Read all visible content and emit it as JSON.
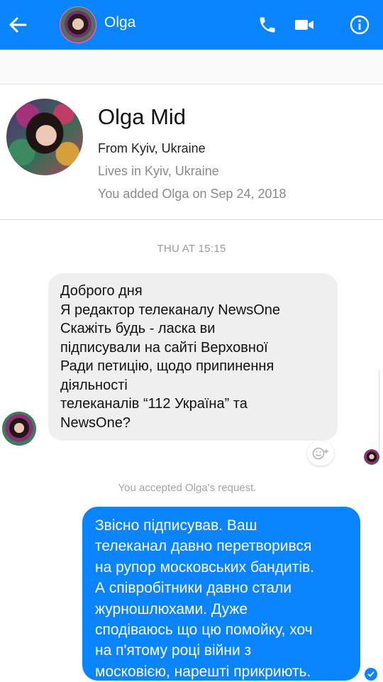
{
  "header": {
    "contact_name": "Olga",
    "accent_color": "#0a84ff",
    "icons": [
      "arrow-left-icon",
      "phone-icon",
      "video-camera-icon",
      "info-icon"
    ]
  },
  "profile": {
    "full_name": "Olga Mid",
    "from": "From Kyiv, Ukraine",
    "lives": "Lives in Kyiv, Ukraine",
    "added": "You added Olga on Sep 24, 2018"
  },
  "conversation": {
    "timestamp": "THU AT 15:15",
    "incoming_message": {
      "lines": [
        "Доброго дня",
        "Я редактор телеканалу NewsOne",
        "Скажіть будь - ласка ви",
        "підписували на сайті Верховної",
        "Ради петицію, щодо припинення",
        "діяльності",
        "телеканалів “112 Україна” та",
        "NewsOne?"
      ]
    },
    "system_note": "You accepted Olga's request.",
    "outgoing_message": {
      "lines": [
        "Звісно підписував.  Ваш",
        "телеканал давно перетворився",
        "на рупор московських бандитів.",
        "А співробітники давно стали",
        "журношлюхами. Дуже",
        "сподіваюсь що цю помойку, хоч",
        "на п'ятому році війни з",
        "московією, нарешті прикриють."
      ]
    }
  }
}
